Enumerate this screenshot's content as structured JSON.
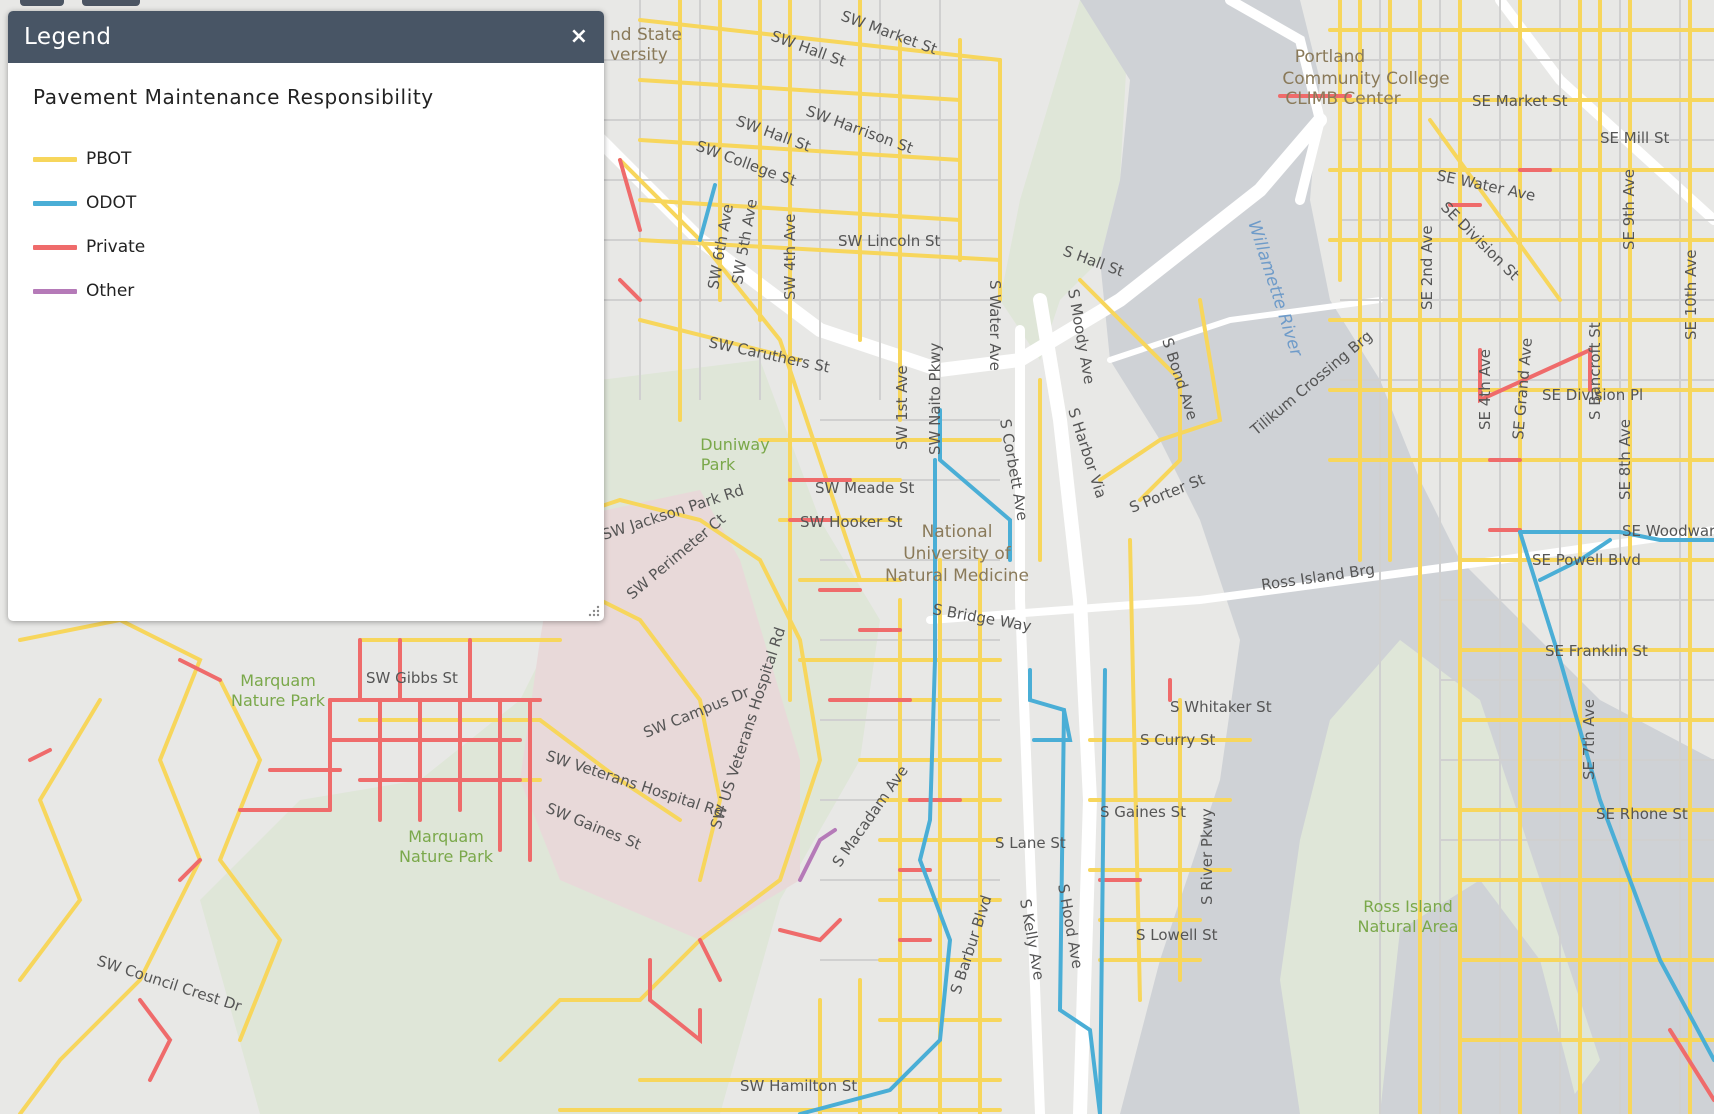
{
  "legend": {
    "title": "Legend",
    "close_symbol": "×",
    "subtitle": "Pavement Maintenance Responsibility",
    "items": [
      {
        "label": "PBOT",
        "color": "#f7d65c"
      },
      {
        "label": "ODOT",
        "color": "#4aaed6"
      },
      {
        "label": "Private",
        "color": "#ef6b6b"
      },
      {
        "label": "Other",
        "color": "#b57ab8"
      }
    ]
  },
  "map": {
    "colors": {
      "pbot": "#f7d65c",
      "odot": "#4aaed6",
      "private": "#ef6b6b",
      "other": "#b57ab8",
      "water": "#cfd2d6",
      "land": "#e8e8e6",
      "park": "#dfe6d8",
      "campus": "#e8d9d9",
      "highway": "#ffffff"
    },
    "street_labels": [
      "SW Market St",
      "SW Hall St",
      "SW Harrison St",
      "SW College St",
      "SW Lincoln St",
      "SW Caruthers St",
      "SW Meade St",
      "SW Hooker St",
      "SW Gibbs St",
      "SW Campus Dr",
      "SW Gaines St",
      "SW Hamilton St",
      "S Hall St",
      "S Porter St",
      "S Whitaker St",
      "S Curry St",
      "S Gaines St",
      "S Lane St",
      "S Lowell St",
      "SE Market St",
      "SE Mill St",
      "SE Water Ave",
      "SE Division Pl",
      "SE Powell Blvd",
      "SE Franklin St",
      "SE Rhone St",
      "SE Woodward",
      "SE Division St",
      "SW 6th Ave",
      "SW 5th Ave",
      "SW 4th Ave",
      "SW 1st Ave",
      "SW Naito Pkwy",
      "S Water Ave",
      "S Moody Ave",
      "S Harbor Via",
      "S Bond Ave",
      "S Hood Ave",
      "S River Pkwy",
      "S Bancroft St",
      "SW Barbur Blvd",
      "SE Grand Ave",
      "SE 2nd Ave",
      "SE 4th Ave",
      "SE 7th Ave",
      "SE 8th Ave",
      "SE 9th Ave",
      "SE 10th Ave",
      "Ross Island Brg",
      "Tilikum Crossing Brg",
      "S Bridge Way",
      "SW Council Crest Dr",
      "SW Perimeter Ct",
      "SW Jackson Park Rd",
      "SW US Veterans Hospital Rd",
      "SW Veterans Hospital Rd",
      "S Corbett Ave",
      "S Kelly Ave",
      "S Macadam Ave"
    ],
    "park_labels": [
      "Duniway Park",
      "Marquam Nature Park",
      "Marquam Nature Park",
      "Ross Island Natural Area"
    ],
    "water_labels": [
      "Willamette River"
    ],
    "place_labels": [
      "Portland Community College CLIMB Center",
      "National University of Natural Medicine",
      "Portland State University"
    ]
  }
}
